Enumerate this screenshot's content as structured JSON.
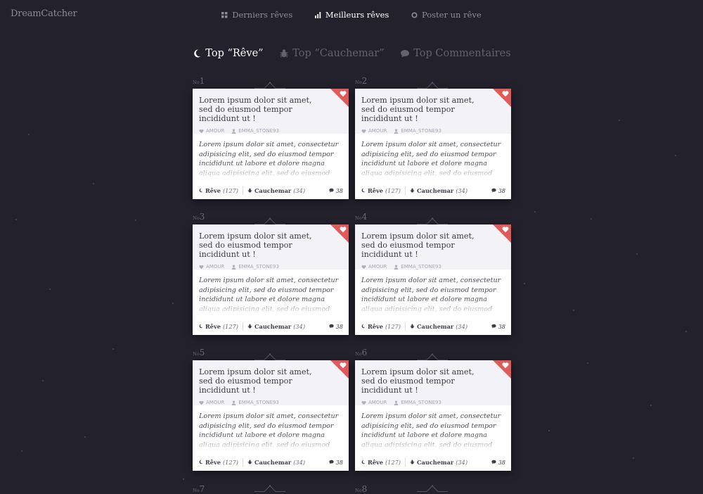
{
  "app": {
    "logo": "DreamCatcher"
  },
  "nav": [
    {
      "label": "Derniers rêves",
      "icon": "grid-icon",
      "active": false
    },
    {
      "label": "Meilleurs rêves",
      "icon": "bars-icon",
      "active": true
    },
    {
      "label": "Poster un rêve",
      "icon": "circle-icon",
      "active": false
    }
  ],
  "tabs": [
    {
      "label": "Top “Rêve”",
      "icon": "moon-icon",
      "active": true
    },
    {
      "label": "Top “Cauchemar”",
      "icon": "bug-icon",
      "active": false
    },
    {
      "label": "Top Commentaires",
      "icon": "comment-icon",
      "active": false
    }
  ],
  "rank_prefix": "No",
  "cards": [
    {
      "rank": "1",
      "title": "Lorem ipsum dolor sit amet, sed do eiusmod tempor incididunt ut !",
      "category": "AMOUR",
      "author": "EMMA_STONE93",
      "excerpt": "Lorem ipsum dolor sit amet, consectetur adipisicing elit, sed do eiusmod tempor incididunt ut labore et dolore magna aliqua adipisicing elit, sed do eiusmod",
      "reve_label": "Rêve",
      "reve_count": "(127)",
      "cauchemar_label": "Cauchemar",
      "cauchemar_count": "(34)",
      "comments": "38"
    },
    {
      "rank": "2",
      "title": "Lorem ipsum dolor sit amet, sed do eiusmod tempor incididunt ut !",
      "category": "AMOUR",
      "author": "EMMA_STONE93",
      "excerpt": "Lorem ipsum dolor sit amet, consectetur adipisicing elit, sed do eiusmod tempor incididunt ut labore et dolore magna aliqua adipisicing elit, sed do eiusmod",
      "reve_label": "Rêve",
      "reve_count": "(127)",
      "cauchemar_label": "Cauchemar",
      "cauchemar_count": "(34)",
      "comments": "38"
    },
    {
      "rank": "3",
      "title": "Lorem ipsum dolor sit amet, sed do eiusmod tempor incididunt ut !",
      "category": "AMOUR",
      "author": "EMMA_STONE93",
      "excerpt": "Lorem ipsum dolor sit amet, consectetur adipisicing elit, sed do eiusmod tempor incididunt ut labore et dolore magna aliqua adipisicing elit, sed do eiusmod",
      "reve_label": "Rêve",
      "reve_count": "(127)",
      "cauchemar_label": "Cauchemar",
      "cauchemar_count": "(34)",
      "comments": "38"
    },
    {
      "rank": "4",
      "title": "Lorem ipsum dolor sit amet, sed do eiusmod tempor incididunt ut !",
      "category": "AMOUR",
      "author": "EMMA_STONE93",
      "excerpt": "Lorem ipsum dolor sit amet, consectetur adipisicing elit, sed do eiusmod tempor incididunt ut labore et dolore magna aliqua adipisicing elit, sed do eiusmod",
      "reve_label": "Rêve",
      "reve_count": "(127)",
      "cauchemar_label": "Cauchemar",
      "cauchemar_count": "(34)",
      "comments": "38"
    },
    {
      "rank": "5",
      "title": "Lorem ipsum dolor sit amet, sed do eiusmod tempor incididunt ut !",
      "category": "AMOUR",
      "author": "EMMA_STONE93",
      "excerpt": "Lorem ipsum dolor sit amet, consectetur adipisicing elit, sed do eiusmod tempor incididunt ut labore et dolore magna aliqua adipisicing elit, sed do eiusmod",
      "reve_label": "Rêve",
      "reve_count": "(127)",
      "cauchemar_label": "Cauchemar",
      "cauchemar_count": "(34)",
      "comments": "38"
    },
    {
      "rank": "6",
      "title": "Lorem ipsum dolor sit amet, sed do eiusmod tempor incididunt ut !",
      "category": "AMOUR",
      "author": "EMMA_STONE93",
      "excerpt": "Lorem ipsum dolor sit amet, consectetur adipisicing elit, sed do eiusmod tempor incididunt ut labore et dolore magna aliqua adipisicing elit, sed do eiusmod",
      "reve_label": "Rêve",
      "reve_count": "(127)",
      "cauchemar_label": "Cauchemar",
      "cauchemar_count": "(34)",
      "comments": "38"
    }
  ],
  "next_ranks": [
    "7",
    "8"
  ],
  "colors": {
    "background": "#23212c",
    "accent": "#e05a5a",
    "card_header": "#f3f2f7"
  }
}
